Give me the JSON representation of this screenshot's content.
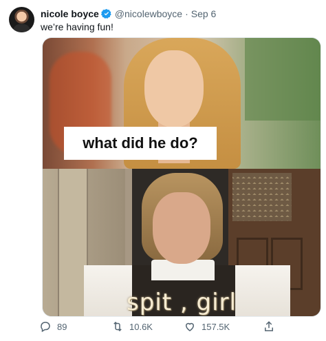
{
  "tweet": {
    "author_name": "nicole boyce",
    "handle": "@nicolewboyce",
    "separator": "·",
    "date": "Sep 6",
    "text": "we’re having fun!"
  },
  "media": {
    "caption_top": "what did he do?",
    "caption_bottom": "spit , girl"
  },
  "actions": {
    "reply_count": "89",
    "retweet_count": "10.6K",
    "like_count": "157.5K"
  },
  "colors": {
    "verified": "#1d9bf0",
    "muted_text": "#536471"
  }
}
